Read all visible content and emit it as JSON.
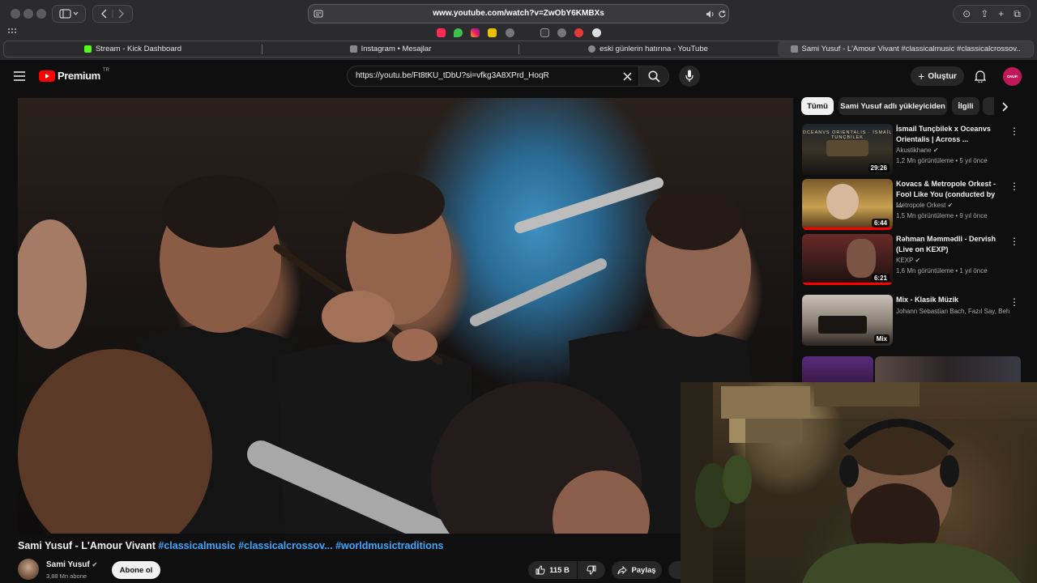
{
  "browser": {
    "url": "www.youtube.com/watch?v=ZwObY6KMBXs",
    "tabs": [
      {
        "title": "Stream - Kick Dashboard"
      },
      {
        "title": "Instagram • Mesajlar"
      },
      {
        "title": "eski günlerin hatırına - YouTube"
      },
      {
        "title": "Sami Yusuf - L'Amour Vivant #classicalmusic #classicalcrossov..."
      }
    ]
  },
  "header": {
    "logo_text": "Premium",
    "logo_region": "TR",
    "search_value": "https://youtu.be/Ft8tKU_tDbU?si=vfkg3A8XPrd_HoqR",
    "create_label": "Oluştur",
    "avatar_text": "ONUR"
  },
  "sidebar": {
    "chips": [
      "Tümü",
      "Sami Yusuf adlı yükleyiciden",
      "İlgili"
    ],
    "recommendations": [
      {
        "title": "İsmail Tunçbilek x Oceanvs Orientalis | Across ...",
        "channel": "Akustikhane",
        "verified": true,
        "meta": "1,2 Mn görüntüleme • 5 yıl önce",
        "duration": "29:26",
        "thumb_text": "OCEANVS ORIENTALIS · İSMAİL TUNÇBİLEK"
      },
      {
        "title": "Kovacs & Metropole Orkest - Fool Like You (conducted by ...",
        "channel": "Metropole Orkest",
        "verified": true,
        "meta": "1,5 Mn görüntüleme • 9 yıl önce",
        "duration": "6:44",
        "thumb_text": ""
      },
      {
        "title": "Rəhman Məmmədli - Dervish (Live on KEXP)",
        "channel": "KEXP",
        "verified": true,
        "meta": "1,6 Mn görüntüleme • 1 yıl önce",
        "duration": "6:21",
        "thumb_text": ""
      },
      {
        "title": "Mix - Klasik Müzik",
        "channel": "Johann Sebastian Bach, Fazıl Say, Behza...",
        "verified": false,
        "meta": "",
        "duration": "Mix",
        "thumb_text": ""
      }
    ]
  },
  "video": {
    "title_main": "Sami Yusuf - L'Amour Vivant ",
    "tag1": "#classicalmusic",
    "tag2": "#classicalcrossov...",
    "tag3": "#worldmusictraditions",
    "channel_name": "Sami Yusuf",
    "subscribers": "3,88 Mn abone",
    "subscribe_label": "Abone ol",
    "likes": "115 B",
    "share_label": "Paylaş"
  },
  "colors": {
    "yt_red": "#ff0000",
    "link_blue": "#3ea6ff",
    "progress_red": "#ff0000"
  }
}
